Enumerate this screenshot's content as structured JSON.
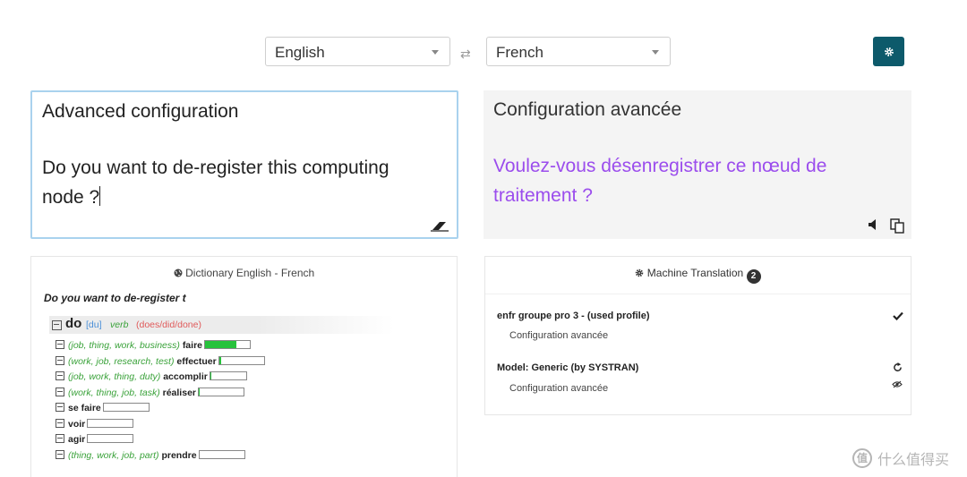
{
  "languages": {
    "source": "English",
    "target": "French",
    "swap_symbol": "⇄"
  },
  "source_text": {
    "line1": "Advanced configuration",
    "line2": "Do you want to de-register this computing node ?"
  },
  "target_text": {
    "line1": "Configuration avancée",
    "line2": "Voulez-vous désenregistrer ce nœud de traitement ?"
  },
  "dictionary": {
    "title": "Dictionary English - French",
    "query": "Do you want to de-register t",
    "entry": {
      "word": "do",
      "pron": "[du]",
      "pos": "verb",
      "forms": "(does/did/done)"
    },
    "senses": [
      {
        "context": "(job, thing, work, business)",
        "translation": "faire",
        "frequency": 0.7
      },
      {
        "context": "(work, job, research, test)",
        "translation": "effectuer",
        "frequency": 0.04
      },
      {
        "context": "(job, work, thing, duty)",
        "translation": "accomplir",
        "frequency": 0.02
      },
      {
        "context": "(work, thing, job, task)",
        "translation": "réaliser",
        "frequency": 0.02
      },
      {
        "context": "",
        "translation": "se faire",
        "frequency": 0.0
      },
      {
        "context": "",
        "translation": "voir",
        "frequency": 0.0
      },
      {
        "context": "",
        "translation": "agir",
        "frequency": 0.0
      },
      {
        "context": "(thing, work, job, part)",
        "translation": "prendre",
        "frequency": 0.0
      }
    ]
  },
  "machine_translation": {
    "title": "Machine Translation",
    "count": "2",
    "results": [
      {
        "name": "enfr groupe pro 3 - (used profile)",
        "translation": "Configuration avancée"
      },
      {
        "name": "Model: Generic (by SYSTRAN)",
        "translation": "Configuration avancée"
      }
    ]
  },
  "watermark": {
    "logo": "值",
    "text": "什么值得买"
  },
  "colors": {
    "accent": "#0d5a6b",
    "translation_text": "#9b4ded",
    "context_text": "#3aa23a",
    "frequency_bar": "#27c23c",
    "forms_text": "#e05a5a",
    "pron_text": "#4a8fd8"
  }
}
